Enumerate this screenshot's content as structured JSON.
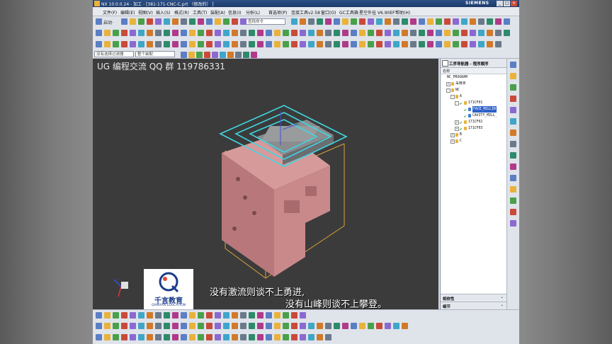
{
  "window": {
    "title": "NX 10.0.0.24 - 加工 - [381-171-CNC-C.prt （修改的） ]",
    "brand": "SIEMENS",
    "controls": [
      "_",
      "□",
      "×"
    ]
  },
  "menu": [
    "文件(F)",
    "编辑(E)",
    "视图(V)",
    "插入(S)",
    "格式(R)",
    "工具(T)",
    "装配(A)",
    "信息(I)",
    "分析(L)",
    "首选项(P)",
    "连接工具v2.58",
    "窗口(O)",
    "GC工具箱",
    "星空外挂 V6.90EF",
    "帮助(H)"
  ],
  "toolbar": {
    "start_label": "启动·",
    "search_placeholder": "查找命令"
  },
  "selection_bar": {
    "filter": "没有选择过滤器",
    "scope": "整个装配"
  },
  "viewport": {
    "watermark": "UG 编程交流 QQ 群 119786331",
    "subtitle_line1": "没有激流则谈不上勇进,",
    "subtitle_line2": "没有山峰则谈不上攀登。",
    "brand_name": "千言教育",
    "brand_en": "QIANYAN EDUCATION"
  },
  "navigator": {
    "title": "工序导航器 - 程序顺序",
    "column": "名称",
    "rows": [
      {
        "label": "NC_PROGRAM",
        "indent": 0,
        "exp": "",
        "check": false,
        "folder": false,
        "selected": false
      },
      {
        "label": "未用项",
        "indent": 1,
        "exp": "+",
        "check": false,
        "folder": true,
        "selected": false
      },
      {
        "label": "NC",
        "indent": 1,
        "exp": "-",
        "check": false,
        "folder": true,
        "selected": false
      },
      {
        "label": "A",
        "indent": 2,
        "exp": "-",
        "check": false,
        "folder": true,
        "selected": false
      },
      {
        "label": "171CF01",
        "indent": 3,
        "exp": "-",
        "check": true,
        "folder": true,
        "selected": false
      },
      {
        "label": "FACE_MILLIN",
        "indent": 4,
        "exp": "",
        "check": true,
        "folder": false,
        "selected": true
      },
      {
        "label": "CAVITY_MILL_",
        "indent": 4,
        "exp": "",
        "check": true,
        "folder": false,
        "selected": false
      },
      {
        "label": "171CF02",
        "indent": 3,
        "exp": "+",
        "check": true,
        "folder": true,
        "selected": false
      },
      {
        "label": "171CF03",
        "indent": 3,
        "exp": "+",
        "check": true,
        "folder": true,
        "selected": false
      },
      {
        "label": "B",
        "indent": 2,
        "exp": "+",
        "check": false,
        "folder": true,
        "selected": false
      },
      {
        "label": "C",
        "indent": 2,
        "exp": "+",
        "check": false,
        "folder": true,
        "selected": false
      }
    ],
    "footer1": "相依性",
    "footer2": "细节"
  },
  "colors": {
    "viewport_bg": "#3b3b3b",
    "part": "#c8888a",
    "toolpath": "#3fd6e0",
    "bbox": "#d9a23a",
    "selection": "#2d62c8"
  }
}
